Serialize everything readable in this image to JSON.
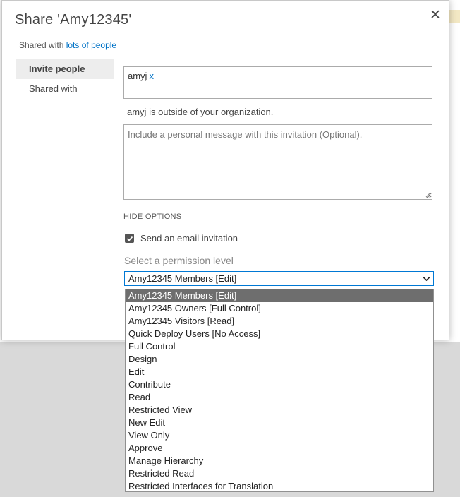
{
  "dialog": {
    "title": "Share 'Amy12345'",
    "close_glyph": "✕",
    "shared_prefix": "Shared with",
    "shared_link": "lots of people"
  },
  "nav": {
    "items": [
      {
        "label": "Invite people",
        "active": true
      },
      {
        "label": "Shared with",
        "active": false
      }
    ]
  },
  "invite": {
    "people": [
      {
        "name": "amyj",
        "remove": "x"
      }
    ],
    "outside_name": "amyj",
    "outside_text": " is outside of your organization.",
    "message_placeholder": "Include a personal message with this invitation (Optional).",
    "hide_options": "HIDE OPTIONS",
    "email_label": "Send an email invitation",
    "email_checked": true,
    "permission_label": "Select a permission level",
    "permission_selected": "Amy12345 Members [Edit]",
    "permission_options": [
      "Amy12345 Members [Edit]",
      "Amy12345 Owners [Full Control]",
      "Amy12345 Visitors [Read]",
      "Quick Deploy Users [No Access]",
      "Full Control",
      "Design",
      "Edit",
      "Contribute",
      "Read",
      "Restricted View",
      "New Edit",
      "View Only",
      "Approve",
      "Manage Hierarchy",
      "Restricted Read",
      "Restricted Interfaces for Translation"
    ]
  },
  "colors": {
    "link": "#0072c6",
    "select_border": "#0078d4",
    "selected_option_bg": "#6e6e6e",
    "overlay": "#d9d9d9"
  }
}
